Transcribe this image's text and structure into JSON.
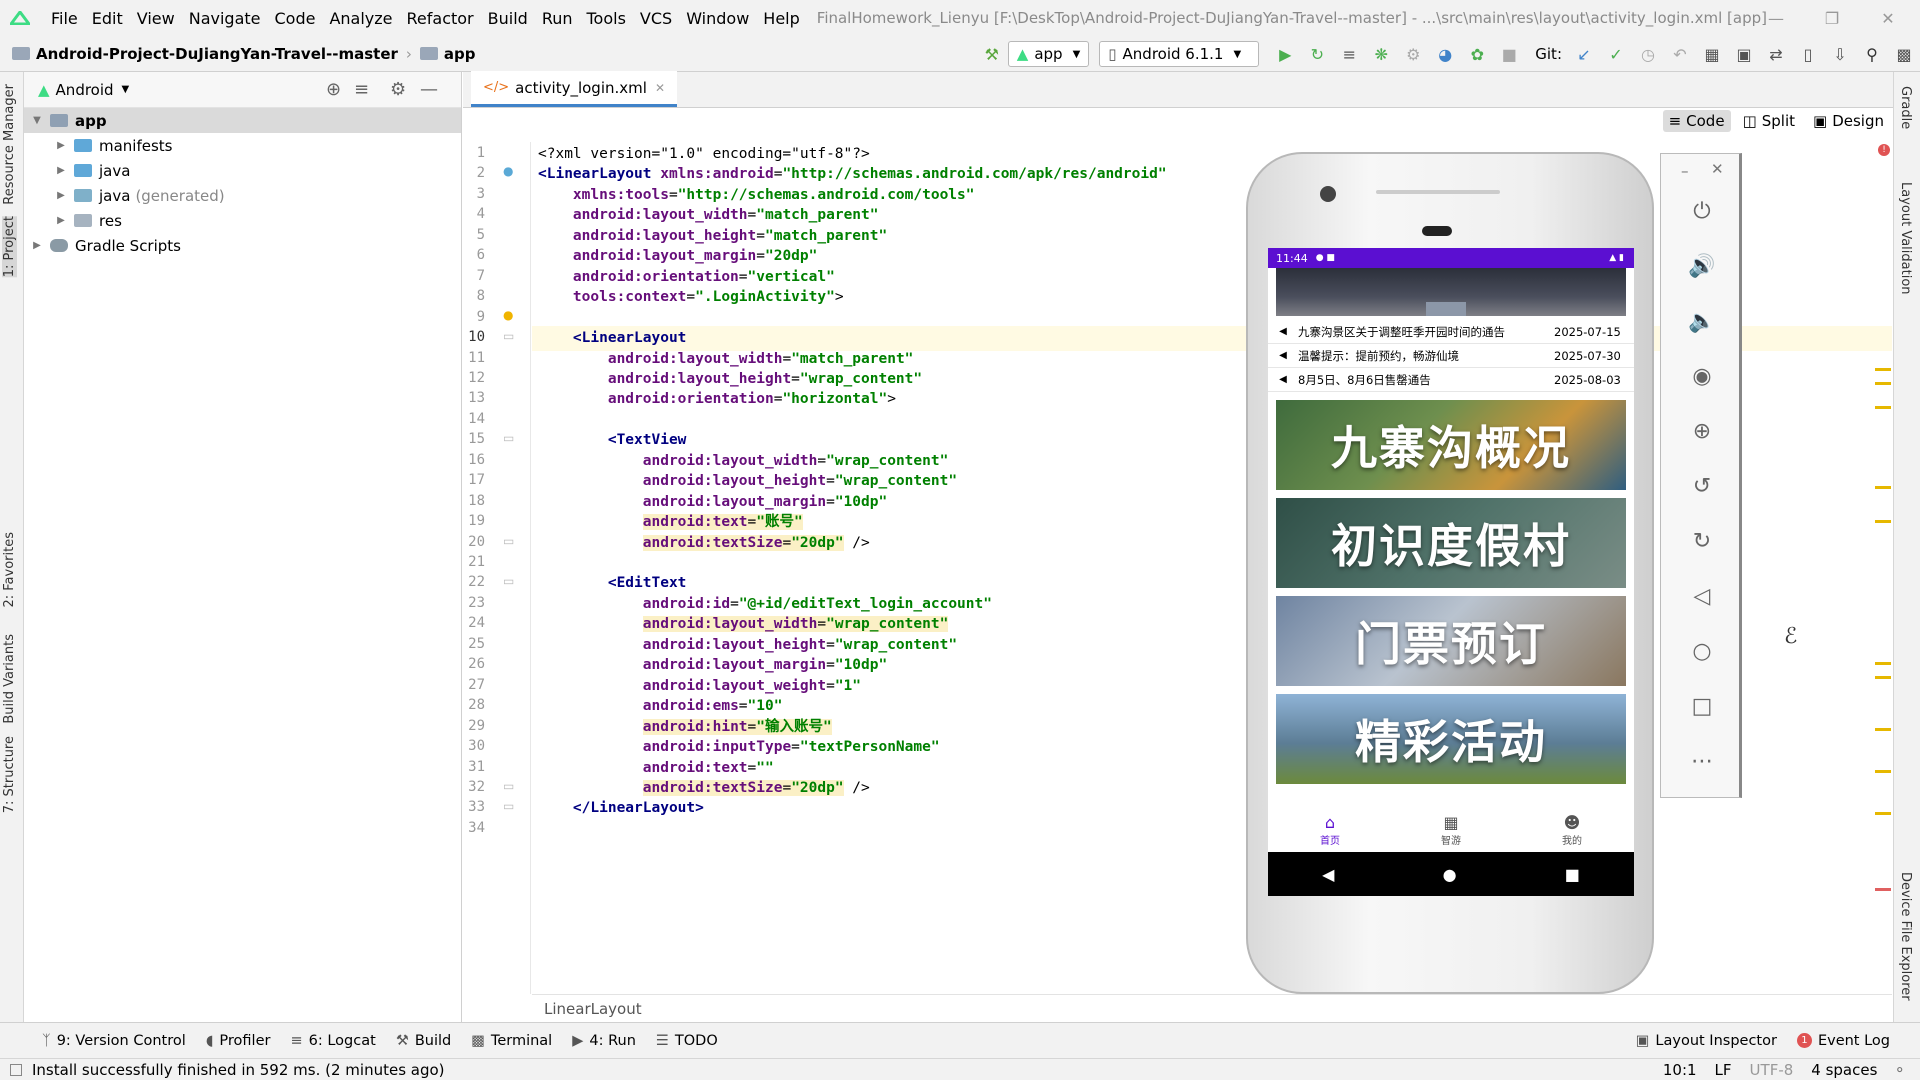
{
  "menu": {
    "items": [
      "File",
      "Edit",
      "View",
      "Navigate",
      "Code",
      "Analyze",
      "Refactor",
      "Build",
      "Run",
      "Tools",
      "VCS",
      "Window",
      "Help"
    ],
    "window_title": "FinalHomework_Lienyu [F:\\DeskTop\\Android-Project-DuJiangYan-Travel--master] - ...\\src\\main\\res\\layout\\activity_login.xml [app]"
  },
  "navbar": {
    "project": "Android-Project-DuJiangYan-Travel--master",
    "module": "app",
    "run_config": "app",
    "device": "Android 6.1.1",
    "git_label": "Git:"
  },
  "project_panel": {
    "view_mode": "Android",
    "tree": [
      {
        "label": "app",
        "level": 0,
        "bold": true
      },
      {
        "label": "manifests",
        "level": 1
      },
      {
        "label": "java",
        "level": 1
      },
      {
        "label": "java",
        "suffix": "(generated)",
        "level": 1
      },
      {
        "label": "res",
        "level": 1
      },
      {
        "label": "Gradle Scripts",
        "level": 0
      }
    ]
  },
  "left_tabs": {
    "resource_manager": "Resource Manager",
    "project": "1: Project",
    "favorites": "2: Favorites",
    "build_variants": "Build Variants",
    "structure": "7: Structure"
  },
  "right_tabs": {
    "gradle": "Gradle",
    "layout_validation": "Layout Validation",
    "device_file_explorer": "Device File Explorer"
  },
  "editor": {
    "tab": "activity_login.xml",
    "view_modes": [
      "Code",
      "Split",
      "Design"
    ],
    "current_line": 10,
    "breadcrumb": "LinearLayout",
    "lines": [
      [
        [
          "p",
          "<?xml version=\"1.0\" encoding=\"utf-8\"?>"
        ]
      ],
      [
        [
          "t",
          "<LinearLayout "
        ],
        [
          "a",
          "xmlns:android"
        ],
        [
          "p",
          "="
        ],
        [
          "v",
          "\"http://schemas.android.com/apk/res/android\""
        ]
      ],
      [
        [
          "p",
          "    "
        ],
        [
          "a",
          "xmlns:tools"
        ],
        [
          "p",
          "="
        ],
        [
          "v",
          "\"http://schemas.android.com/tools\""
        ]
      ],
      [
        [
          "p",
          "    "
        ],
        [
          "a",
          "android:layout_width"
        ],
        [
          "p",
          "="
        ],
        [
          "v",
          "\"match_parent\""
        ]
      ],
      [
        [
          "p",
          "    "
        ],
        [
          "a",
          "android:layout_height"
        ],
        [
          "p",
          "="
        ],
        [
          "v",
          "\"match_parent\""
        ]
      ],
      [
        [
          "p",
          "    "
        ],
        [
          "a",
          "android:layout_margin"
        ],
        [
          "p",
          "="
        ],
        [
          "v",
          "\"20dp\""
        ]
      ],
      [
        [
          "p",
          "    "
        ],
        [
          "a",
          "android:orientation"
        ],
        [
          "p",
          "="
        ],
        [
          "v",
          "\"vertical\""
        ]
      ],
      [
        [
          "p",
          "    "
        ],
        [
          "a",
          "tools:context"
        ],
        [
          "p",
          "="
        ],
        [
          "v",
          "\".LoginActivity\""
        ],
        [
          "p",
          ">"
        ]
      ],
      [
        [
          "p",
          ""
        ]
      ],
      [
        [
          "p",
          "    "
        ],
        [
          "t",
          "<LinearLayout"
        ]
      ],
      [
        [
          "p",
          "        "
        ],
        [
          "a",
          "android:layout_width"
        ],
        [
          "p",
          "="
        ],
        [
          "v",
          "\"match_parent\""
        ]
      ],
      [
        [
          "p",
          "        "
        ],
        [
          "a",
          "android:layout_height"
        ],
        [
          "p",
          "="
        ],
        [
          "v",
          "\"wrap_content\""
        ]
      ],
      [
        [
          "p",
          "        "
        ],
        [
          "a",
          "android:orientation"
        ],
        [
          "p",
          "="
        ],
        [
          "v",
          "\"horizontal\""
        ],
        [
          "p",
          ">"
        ]
      ],
      [
        [
          "p",
          ""
        ]
      ],
      [
        [
          "p",
          "        "
        ],
        [
          "t",
          "<TextView"
        ]
      ],
      [
        [
          "p",
          "            "
        ],
        [
          "a",
          "android:layout_width"
        ],
        [
          "p",
          "="
        ],
        [
          "v",
          "\"wrap_content\""
        ]
      ],
      [
        [
          "p",
          "            "
        ],
        [
          "a",
          "android:layout_height"
        ],
        [
          "p",
          "="
        ],
        [
          "v",
          "\"wrap_content\""
        ]
      ],
      [
        [
          "p",
          "            "
        ],
        [
          "a",
          "android:layout_margin"
        ],
        [
          "p",
          "="
        ],
        [
          "v",
          "\"10dp\""
        ]
      ],
      [
        [
          "p",
          "            "
        ],
        [
          "ah",
          "android:text"
        ],
        [
          "ph",
          "="
        ],
        [
          "vh",
          "\"账号\""
        ]
      ],
      [
        [
          "p",
          "            "
        ],
        [
          "ah",
          "android:textSize"
        ],
        [
          "ph",
          "="
        ],
        [
          "vh",
          "\"20dp\""
        ],
        [
          "p",
          " />"
        ]
      ],
      [
        [
          "p",
          ""
        ]
      ],
      [
        [
          "p",
          "        "
        ],
        [
          "t",
          "<EditText"
        ]
      ],
      [
        [
          "p",
          "            "
        ],
        [
          "a",
          "android:id"
        ],
        [
          "p",
          "="
        ],
        [
          "v",
          "\"@+id/editText_login_account\""
        ]
      ],
      [
        [
          "p",
          "            "
        ],
        [
          "ah",
          "android:layout_width"
        ],
        [
          "ph",
          "="
        ],
        [
          "vh",
          "\"wrap_content\""
        ]
      ],
      [
        [
          "p",
          "            "
        ],
        [
          "a",
          "android:layout_height"
        ],
        [
          "p",
          "="
        ],
        [
          "v",
          "\"wrap_content\""
        ]
      ],
      [
        [
          "p",
          "            "
        ],
        [
          "a",
          "android:layout_margin"
        ],
        [
          "p",
          "="
        ],
        [
          "v",
          "\"10dp\""
        ]
      ],
      [
        [
          "p",
          "            "
        ],
        [
          "a",
          "android:layout_weight"
        ],
        [
          "p",
          "="
        ],
        [
          "v",
          "\"1\""
        ]
      ],
      [
        [
          "p",
          "            "
        ],
        [
          "a",
          "android:ems"
        ],
        [
          "p",
          "="
        ],
        [
          "v",
          "\"10\""
        ]
      ],
      [
        [
          "p",
          "            "
        ],
        [
          "ah",
          "android:hint"
        ],
        [
          "ph",
          "="
        ],
        [
          "vh",
          "\"输入账号\""
        ]
      ],
      [
        [
          "p",
          "            "
        ],
        [
          "a",
          "android:inputType"
        ],
        [
          "p",
          "="
        ],
        [
          "v",
          "\"textPersonName\""
        ]
      ],
      [
        [
          "p",
          "            "
        ],
        [
          "a",
          "android:text"
        ],
        [
          "p",
          "="
        ],
        [
          "v",
          "\"\""
        ]
      ],
      [
        [
          "p",
          "            "
        ],
        [
          "ah",
          "android:textSize"
        ],
        [
          "ph",
          "="
        ],
        [
          "vh",
          "\"20dp\""
        ],
        [
          "p",
          " />"
        ]
      ],
      [
        [
          "p",
          "    "
        ],
        [
          "t",
          "</LinearLayout>"
        ]
      ],
      [
        [
          "p",
          ""
        ]
      ]
    ]
  },
  "phone": {
    "time": "11:44",
    "notices": [
      {
        "text": "九寨沟景区关于调整旺季开园时间的通告",
        "date": "2025-07-15"
      },
      {
        "text": "温馨提示：提前预约，畅游仙境",
        "date": "2025-07-30"
      },
      {
        "text": "8月5日、8月6日售罄通告",
        "date": "2025-08-03"
      }
    ],
    "banners": [
      "九寨沟概况",
      "初识度假村",
      "门票预订",
      "精彩活动"
    ],
    "tabs": [
      "首页",
      "智游",
      "我的"
    ]
  },
  "bottom_tools": {
    "left": [
      "9: Version Control",
      "Profiler",
      "6: Logcat",
      "Build",
      "Terminal",
      "4: Run",
      "TODO"
    ],
    "right": [
      "Layout Inspector",
      "Event Log"
    ],
    "event_count": "1"
  },
  "status": {
    "message": "Install successfully finished in 592 ms. (2 minutes ago)",
    "position": "10:1",
    "line_sep": "LF",
    "encoding": "UTF-8",
    "indent": "4 spaces"
  },
  "colors": {
    "accent": "#4083c9",
    "status_purple": "#5b0fd1",
    "tag": "#000080",
    "attr": "#660e7a",
    "value": "#008000"
  }
}
